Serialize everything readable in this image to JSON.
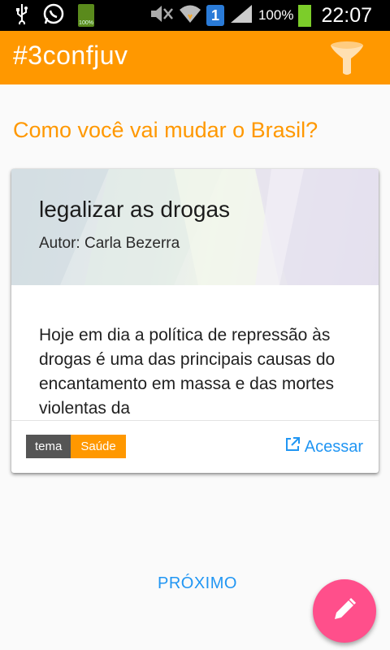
{
  "status_bar": {
    "battery_small_label": "100%",
    "sim_label": "1",
    "battery_percent": "100%",
    "time": "22:07"
  },
  "app_bar": {
    "title": "#3confjuv",
    "filter_icon": "filter-funnel-icon"
  },
  "question": "Como você vai mudar o Brasil?",
  "card": {
    "title": "legalizar as drogas",
    "author": "Autor: Carla Bezerra",
    "body": "Hoje em dia a política de repressão às drogas é uma das principais causas do encantamento em massa e das mortes violentas da",
    "tag_key": "tema",
    "tag_value": "Saúde",
    "access_label": "Acessar",
    "access_icon": "open-in-new-icon"
  },
  "next_label": "PRÓXIMO",
  "fab_icon": "pencil-edit-icon",
  "colors": {
    "primary": "#ff9800",
    "accent": "#ff4f8b",
    "link": "#2196f3"
  }
}
